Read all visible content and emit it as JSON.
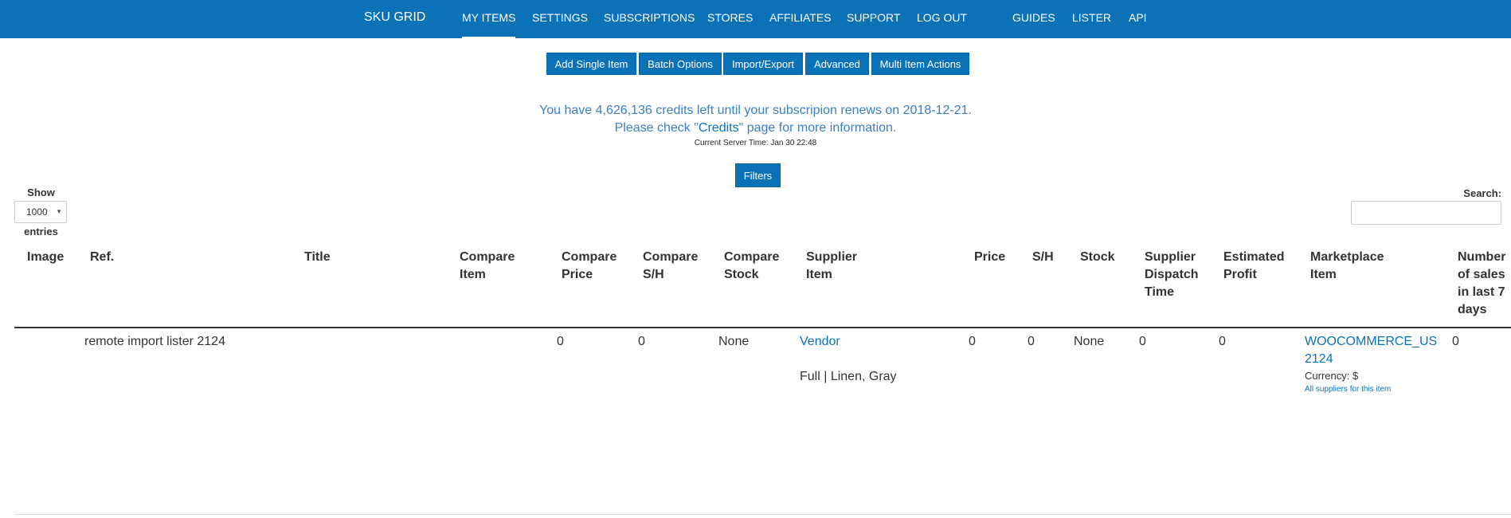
{
  "nav": {
    "brand": "SKU GRID",
    "items": [
      "MY ITEMS",
      "SETTINGS",
      "SUBSCRIPTIONS",
      "STORES",
      "AFFILIATES",
      "SUPPORT",
      "LOG OUT"
    ],
    "right_items": [
      "GUIDES",
      "LISTER",
      "API"
    ],
    "active": "MY ITEMS"
  },
  "actions": [
    "Add Single Item",
    "Batch Options",
    "Import/Export",
    "Advanced",
    "Multi Item Actions"
  ],
  "credits": {
    "line1": "You have 4,626,136 credits left until your subscripion renews on 2018-12-21.",
    "line2_pre": "Please check \"",
    "line2_link": "Credits",
    "line2_post": "\" page for more information.",
    "server_time": "Current Server Time: Jan 30 22:48"
  },
  "filters_label": "Filters",
  "length": {
    "show_label": "Show",
    "value": "1000",
    "entries_label": "entries"
  },
  "search": {
    "label": "Search:",
    "value": ""
  },
  "table": {
    "headers": [
      "Image",
      "Ref.",
      "Title",
      "Compare Item",
      "Compare Price",
      "Compare S/H",
      "Compare Stock",
      "Supplier Item",
      "Price",
      "S/H",
      "Stock",
      "Supplier Dispatch Time",
      "Estimated Profit",
      "Marketplace Item",
      "Number of sales in last 7 days"
    ],
    "rows": [
      {
        "image": "",
        "ref": "remote import lister 2124",
        "title": "",
        "compare_item": "",
        "compare_price": "0",
        "compare_sh": "0",
        "compare_stock": "None",
        "supplier_item": "Vendor",
        "supplier_variant": "Full | Linen, Gray",
        "price": "0",
        "sh": "0",
        "stock": "None",
        "dispatch_time": "0",
        "estimated_profit": "0",
        "marketplace_item": "WOOCOMMERCE_US 2124",
        "currency": "Currency: $",
        "all_suppliers_link": "All suppliers for this item",
        "sales_7d": "0"
      }
    ]
  },
  "colors": {
    "primary": "#0b72b8",
    "link": "#0b72b8",
    "info_text": "#3a7fc1"
  }
}
